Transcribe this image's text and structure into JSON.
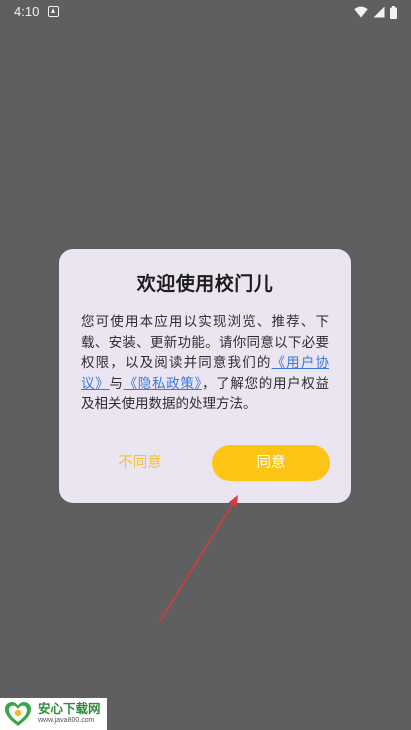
{
  "status_bar": {
    "time": "4:10",
    "icons": [
      "notification-icon",
      "wifi-icon",
      "signal-icon",
      "battery-icon"
    ]
  },
  "dialog": {
    "title": "欢迎使用校门儿",
    "body_intro": "您可使用本应用以实现浏览、推荐、下载、安装、更新功能。请你同意以下必要权限，以及阅读并同意我们的",
    "user_agreement_link": "《用户协议》",
    "connector": "与",
    "privacy_policy_link": "《隐私政策》",
    "body_outro": "，了解您的用户权益及相关使用数据的处理方法。",
    "disagree_label": "不同意",
    "agree_label": "同意"
  },
  "watermark": {
    "title": "安心下载网",
    "url": "www.java800.com"
  },
  "colors": {
    "overlay": "#5f5f5f",
    "dialog_bg": "#ebe5f2",
    "accent": "#fcc415",
    "link": "#3a78d8",
    "arrow": "#d93a3a"
  }
}
